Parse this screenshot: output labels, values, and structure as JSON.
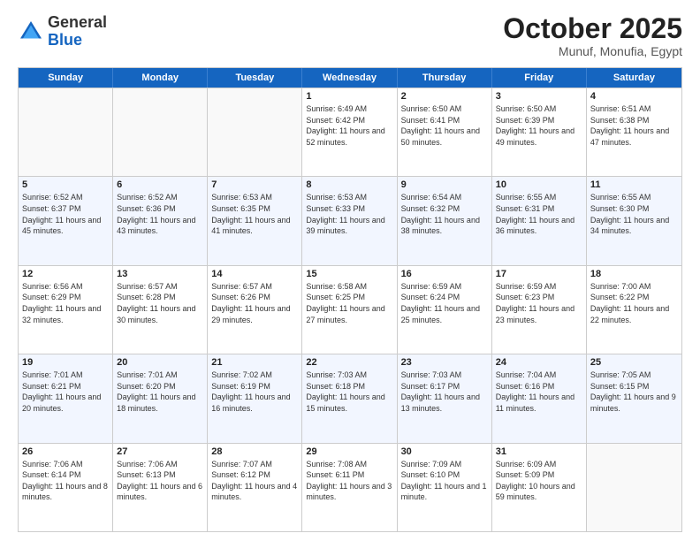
{
  "header": {
    "logo_general": "General",
    "logo_blue": "Blue",
    "month": "October 2025",
    "location": "Munuf, Monufia, Egypt"
  },
  "days_of_week": [
    "Sunday",
    "Monday",
    "Tuesday",
    "Wednesday",
    "Thursday",
    "Friday",
    "Saturday"
  ],
  "weeks": [
    {
      "cells": [
        {
          "day": "",
          "sunrise": "",
          "sunset": "",
          "daylight": ""
        },
        {
          "day": "",
          "sunrise": "",
          "sunset": "",
          "daylight": ""
        },
        {
          "day": "",
          "sunrise": "",
          "sunset": "",
          "daylight": ""
        },
        {
          "day": "1",
          "sunrise": "Sunrise: 6:49 AM",
          "sunset": "Sunset: 6:42 PM",
          "daylight": "Daylight: 11 hours and 52 minutes."
        },
        {
          "day": "2",
          "sunrise": "Sunrise: 6:50 AM",
          "sunset": "Sunset: 6:41 PM",
          "daylight": "Daylight: 11 hours and 50 minutes."
        },
        {
          "day": "3",
          "sunrise": "Sunrise: 6:50 AM",
          "sunset": "Sunset: 6:39 PM",
          "daylight": "Daylight: 11 hours and 49 minutes."
        },
        {
          "day": "4",
          "sunrise": "Sunrise: 6:51 AM",
          "sunset": "Sunset: 6:38 PM",
          "daylight": "Daylight: 11 hours and 47 minutes."
        }
      ]
    },
    {
      "cells": [
        {
          "day": "5",
          "sunrise": "Sunrise: 6:52 AM",
          "sunset": "Sunset: 6:37 PM",
          "daylight": "Daylight: 11 hours and 45 minutes."
        },
        {
          "day": "6",
          "sunrise": "Sunrise: 6:52 AM",
          "sunset": "Sunset: 6:36 PM",
          "daylight": "Daylight: 11 hours and 43 minutes."
        },
        {
          "day": "7",
          "sunrise": "Sunrise: 6:53 AM",
          "sunset": "Sunset: 6:35 PM",
          "daylight": "Daylight: 11 hours and 41 minutes."
        },
        {
          "day": "8",
          "sunrise": "Sunrise: 6:53 AM",
          "sunset": "Sunset: 6:33 PM",
          "daylight": "Daylight: 11 hours and 39 minutes."
        },
        {
          "day": "9",
          "sunrise": "Sunrise: 6:54 AM",
          "sunset": "Sunset: 6:32 PM",
          "daylight": "Daylight: 11 hours and 38 minutes."
        },
        {
          "day": "10",
          "sunrise": "Sunrise: 6:55 AM",
          "sunset": "Sunset: 6:31 PM",
          "daylight": "Daylight: 11 hours and 36 minutes."
        },
        {
          "day": "11",
          "sunrise": "Sunrise: 6:55 AM",
          "sunset": "Sunset: 6:30 PM",
          "daylight": "Daylight: 11 hours and 34 minutes."
        }
      ]
    },
    {
      "cells": [
        {
          "day": "12",
          "sunrise": "Sunrise: 6:56 AM",
          "sunset": "Sunset: 6:29 PM",
          "daylight": "Daylight: 11 hours and 32 minutes."
        },
        {
          "day": "13",
          "sunrise": "Sunrise: 6:57 AM",
          "sunset": "Sunset: 6:28 PM",
          "daylight": "Daylight: 11 hours and 30 minutes."
        },
        {
          "day": "14",
          "sunrise": "Sunrise: 6:57 AM",
          "sunset": "Sunset: 6:26 PM",
          "daylight": "Daylight: 11 hours and 29 minutes."
        },
        {
          "day": "15",
          "sunrise": "Sunrise: 6:58 AM",
          "sunset": "Sunset: 6:25 PM",
          "daylight": "Daylight: 11 hours and 27 minutes."
        },
        {
          "day": "16",
          "sunrise": "Sunrise: 6:59 AM",
          "sunset": "Sunset: 6:24 PM",
          "daylight": "Daylight: 11 hours and 25 minutes."
        },
        {
          "day": "17",
          "sunrise": "Sunrise: 6:59 AM",
          "sunset": "Sunset: 6:23 PM",
          "daylight": "Daylight: 11 hours and 23 minutes."
        },
        {
          "day": "18",
          "sunrise": "Sunrise: 7:00 AM",
          "sunset": "Sunset: 6:22 PM",
          "daylight": "Daylight: 11 hours and 22 minutes."
        }
      ]
    },
    {
      "cells": [
        {
          "day": "19",
          "sunrise": "Sunrise: 7:01 AM",
          "sunset": "Sunset: 6:21 PM",
          "daylight": "Daylight: 11 hours and 20 minutes."
        },
        {
          "day": "20",
          "sunrise": "Sunrise: 7:01 AM",
          "sunset": "Sunset: 6:20 PM",
          "daylight": "Daylight: 11 hours and 18 minutes."
        },
        {
          "day": "21",
          "sunrise": "Sunrise: 7:02 AM",
          "sunset": "Sunset: 6:19 PM",
          "daylight": "Daylight: 11 hours and 16 minutes."
        },
        {
          "day": "22",
          "sunrise": "Sunrise: 7:03 AM",
          "sunset": "Sunset: 6:18 PM",
          "daylight": "Daylight: 11 hours and 15 minutes."
        },
        {
          "day": "23",
          "sunrise": "Sunrise: 7:03 AM",
          "sunset": "Sunset: 6:17 PM",
          "daylight": "Daylight: 11 hours and 13 minutes."
        },
        {
          "day": "24",
          "sunrise": "Sunrise: 7:04 AM",
          "sunset": "Sunset: 6:16 PM",
          "daylight": "Daylight: 11 hours and 11 minutes."
        },
        {
          "day": "25",
          "sunrise": "Sunrise: 7:05 AM",
          "sunset": "Sunset: 6:15 PM",
          "daylight": "Daylight: 11 hours and 9 minutes."
        }
      ]
    },
    {
      "cells": [
        {
          "day": "26",
          "sunrise": "Sunrise: 7:06 AM",
          "sunset": "Sunset: 6:14 PM",
          "daylight": "Daylight: 11 hours and 8 minutes."
        },
        {
          "day": "27",
          "sunrise": "Sunrise: 7:06 AM",
          "sunset": "Sunset: 6:13 PM",
          "daylight": "Daylight: 11 hours and 6 minutes."
        },
        {
          "day": "28",
          "sunrise": "Sunrise: 7:07 AM",
          "sunset": "Sunset: 6:12 PM",
          "daylight": "Daylight: 11 hours and 4 minutes."
        },
        {
          "day": "29",
          "sunrise": "Sunrise: 7:08 AM",
          "sunset": "Sunset: 6:11 PM",
          "daylight": "Daylight: 11 hours and 3 minutes."
        },
        {
          "day": "30",
          "sunrise": "Sunrise: 7:09 AM",
          "sunset": "Sunset: 6:10 PM",
          "daylight": "Daylight: 11 hours and 1 minute."
        },
        {
          "day": "31",
          "sunrise": "Sunrise: 6:09 AM",
          "sunset": "Sunset: 5:09 PM",
          "daylight": "Daylight: 10 hours and 59 minutes."
        },
        {
          "day": "",
          "sunrise": "",
          "sunset": "",
          "daylight": ""
        }
      ]
    }
  ]
}
